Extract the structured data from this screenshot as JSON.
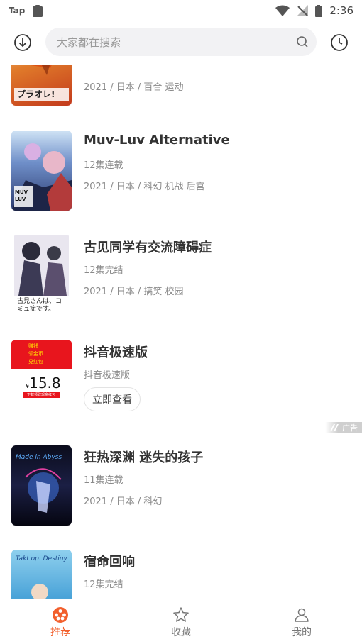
{
  "status_bar": {
    "carrier": "Tap",
    "time": "2:36"
  },
  "search": {
    "placeholder": "大家都在搜索"
  },
  "colors": {
    "accent": "#f25f2c",
    "text": "#333333",
    "muted": "#8a8a8a",
    "search_bg": "#f2f2f4"
  },
  "list": {
    "items": [
      {
        "title": "",
        "subline": "",
        "meta": "2021 / 日本 / 百合 运动",
        "cover_label": "プラオレ!"
      },
      {
        "title": "Muv-Luv Alternative",
        "subline": "12集连载",
        "meta": "2021 / 日本 / 科幻 机战 后宫",
        "cover_label": "MUV LUV"
      },
      {
        "title": "古见同学有交流障碍症",
        "subline": "12集完结",
        "meta": "2021 / 日本 / 搞笑 校园",
        "cover_label": "古見さんは、コミュ症です。"
      },
      {
        "title": "抖音极速版",
        "subline": "抖音极速版",
        "meta": "",
        "button": "立即查看",
        "ad_label": "广告",
        "cover_lines": [
          "赚钱",
          "领金币",
          "兑红包"
        ],
        "cover_price": "15.8",
        "cover_currency": "¥",
        "cover_button": "下载领取现金红包"
      },
      {
        "title": "狂热深渊 迷失的孩子",
        "subline": "11集连载",
        "meta": "2021 / 日本 / 科幻",
        "cover_label": "Made in Abyss"
      },
      {
        "title": "宿命回响",
        "subline": "12集完结",
        "meta": "",
        "cover_label": "Takt op. Destiny"
      }
    ]
  },
  "bottom_nav": {
    "items": [
      {
        "label": "推荐",
        "icon": "film-reel-icon",
        "active": true
      },
      {
        "label": "收藏",
        "icon": "star-icon",
        "active": false
      },
      {
        "label": "我的",
        "icon": "user-icon",
        "active": false
      }
    ]
  }
}
